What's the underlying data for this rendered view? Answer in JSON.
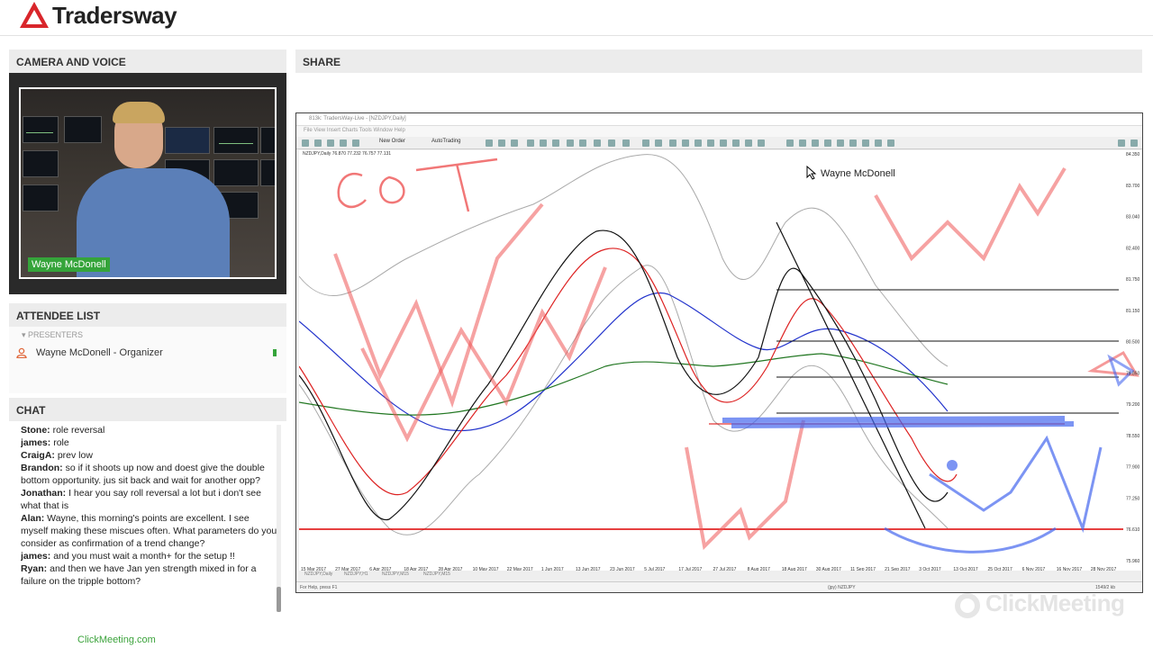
{
  "brand": {
    "name": "Tradersway",
    "logo_color": "#d9262b"
  },
  "camera": {
    "header": "CAMERA AND VOICE",
    "presenter_tag": "Wayne McDonell"
  },
  "share": {
    "header": "SHARE"
  },
  "attendees": {
    "header": "ATTENDEE LIST",
    "group_label": "PRESENTERS",
    "items": [
      {
        "name": "Wayne McDonell - Organizer",
        "icon": "person-icon",
        "status": "mic-on-icon"
      }
    ]
  },
  "chat": {
    "header": "CHAT",
    "messages": [
      {
        "author": "Stone:",
        "text": " role reversal"
      },
      {
        "author": "james:",
        "text": " role"
      },
      {
        "author": "CraigA:",
        "text": " prev low"
      },
      {
        "author": "Brandon:",
        "text": " so if it shoots up now and doest give the double bottom opportunity. jus sit back and wait for another opp?"
      },
      {
        "author": "Jonathan:",
        "text": " I hear you say roll reversal a lot but i don't see what that is"
      },
      {
        "author": "Alan:",
        "text": " Wayne, this morning's points are excellent.  I see myself making these miscues often.  What parameters do you consider as confirmation of a trend change?"
      },
      {
        "author": "james:",
        "text": " and you must wait a month+ for the setup !!"
      },
      {
        "author": "Ryan:",
        "text": " and then we have Jan yen strength mixed in for a failure on the tripple bottom?"
      }
    ]
  },
  "shared_screen": {
    "window_title": "813k: TradersWay-Live - [NZDJPY,Daily]",
    "menu": "File   View   Insert   Charts   Tools   Window   Help",
    "toolbar": {
      "new_order": "New Order",
      "autotrading": "AutoTrading"
    },
    "symbol_line": "NZDJPY,Daily  76.870 77.232 76.757 77.131",
    "overlay_name": "Wayne McDonell",
    "annotation_text": "COT",
    "tabs": [
      "NZDJPY,Daily",
      "NZDJPY,H1",
      "NZDJPY,M15",
      "NZDJPY,M15"
    ],
    "status_left": "For Help, press F1",
    "status_mid": "(jpy) NZDJPY",
    "status_right": "1549/2 kb",
    "x_dates": [
      "15 Mar 2017",
      "27 Mar 2017",
      "6 Apr 2017",
      "18 Apr 2017",
      "28 Apr 2017",
      "10 May 2017",
      "22 May 2017",
      "1 Jun 2017",
      "13 Jun 2017",
      "23 Jun 2017",
      "5 Jul 2017",
      "17 Jul 2017",
      "27 Jul 2017",
      "8 Aug 2017",
      "18 Aug 2017",
      "30 Aug 2017",
      "11 Sep 2017",
      "21 Sep 2017",
      "3 Oct 2017",
      "13 Oct 2017",
      "25 Oct 2017",
      "6 Nov 2017",
      "16 Nov 2017",
      "28 Nov 2017"
    ],
    "y_ticks": [
      "84.350",
      "83.700",
      "83.040",
      "82.400",
      "81.750",
      "81.150",
      "80.500",
      "79.850",
      "79.200",
      "78.550",
      "77.900",
      "77.250",
      "76.610",
      "75.960"
    ]
  },
  "footer": {
    "link": "ClickMeeting.com",
    "watermark": "ClickMeeting"
  }
}
